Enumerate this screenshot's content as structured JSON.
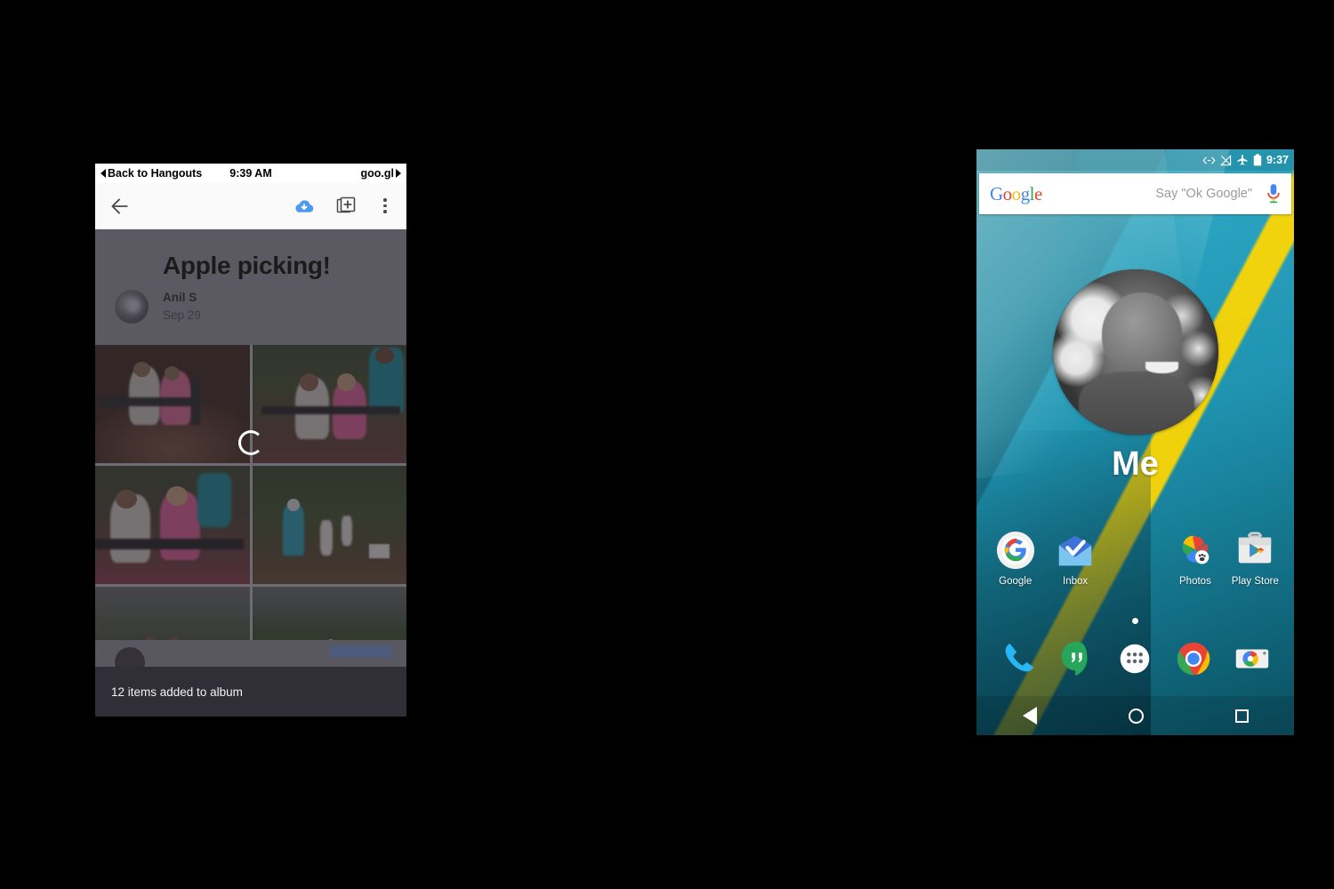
{
  "ios": {
    "status_bar": {
      "back_label": "Back to Hangouts",
      "time": "9:39 AM",
      "right_label": "goo.gl"
    },
    "toolbar": {
      "back_icon": "arrow-left-icon",
      "save_icon": "cloud-download-icon",
      "add_icon": "add-to-album-icon",
      "overflow_icon": "more-vertical-icon"
    },
    "album": {
      "title": "Apple picking!",
      "author": "Anil S",
      "date": "Sep 29",
      "avatar": "user-avatar"
    },
    "grid": {
      "loading_icon": "loading-spinner",
      "photos": [
        {
          "alt": "two girls sitting on bench on dirt mound"
        },
        {
          "alt": "two girls on bench with man in teal shirt"
        },
        {
          "alt": "two girls laughing on bench close up"
        },
        {
          "alt": "man and children walking up orchard path"
        },
        {
          "alt": "two children walking away in orchard"
        },
        {
          "alt": "child in pink walking through apple orchard"
        }
      ]
    },
    "toast": {
      "message": "12 items added to album"
    }
  },
  "android": {
    "status_bar": {
      "time": "9:37",
      "icons": [
        "usb-debug-icon",
        "signal-off-icon",
        "airplane-mode-icon",
        "battery-icon"
      ]
    },
    "search": {
      "logo": "Google",
      "logo_letters": [
        "G",
        "o",
        "o",
        "g",
        "l",
        "e"
      ],
      "placeholder": "Say \"Ok Google\"",
      "mic_icon": "microphone-icon"
    },
    "widget": {
      "label": "Me",
      "photo": "profile-photo"
    },
    "apps": [
      {
        "label": "Google",
        "icon": "google-app-icon"
      },
      {
        "label": "Inbox",
        "icon": "inbox-app-icon"
      },
      {
        "label": "",
        "icon": "empty-slot"
      },
      {
        "label": "Photos",
        "icon": "google-photos-icon"
      },
      {
        "label": "Play Store",
        "icon": "play-store-icon"
      }
    ],
    "page_indicator": {
      "pages": 1,
      "current": 1
    },
    "dock": [
      {
        "icon": "phone-icon",
        "name": "Phone"
      },
      {
        "icon": "hangouts-icon",
        "name": "Hangouts"
      },
      {
        "icon": "app-drawer-icon",
        "name": "All apps"
      },
      {
        "icon": "chrome-icon",
        "name": "Chrome"
      },
      {
        "icon": "camera-icon",
        "name": "Camera"
      }
    ],
    "navbar": [
      {
        "icon": "nav-back-icon"
      },
      {
        "icon": "nav-home-icon"
      },
      {
        "icon": "nav-recents-icon"
      }
    ]
  },
  "colors": {
    "google_blue": "#4285F4",
    "google_red": "#EA4335",
    "google_yellow": "#FBBC05",
    "google_green": "#34A853",
    "wallpaper_teal": "#2fa8c4",
    "wallpaper_yellow": "#FFD600",
    "album_header_bg": "#5b5962",
    "toast_bg": "#302e36"
  }
}
